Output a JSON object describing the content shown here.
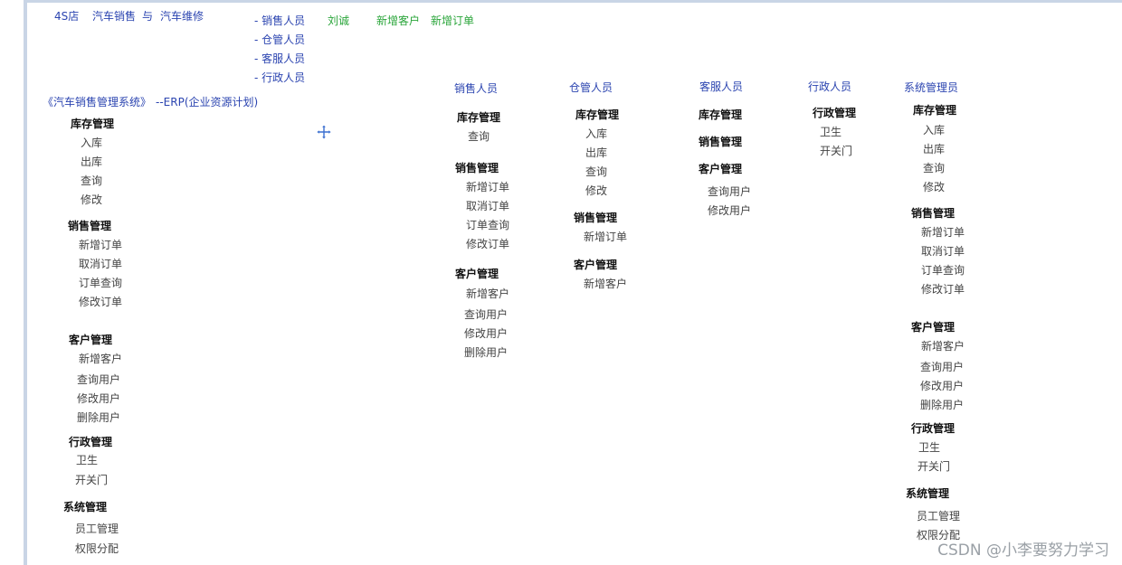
{
  "header": {
    "brand": "4S店",
    "brand_sub1": "汽车销售",
    "brand_and": "与",
    "brand_sub2": "汽车维修",
    "roles": [
      "- 销售人员",
      "- 仓管人员",
      "- 客服人员",
      "- 行政人员"
    ],
    "person": "刘诚",
    "action1": "新增客户",
    "action2": "新增订单"
  },
  "system_title": "《汽车销售管理系统》",
  "system_subtitle": "--ERP(企业资源计划)",
  "full_tree": {
    "inventory": {
      "title": "库存管理",
      "items": [
        "入库",
        "出库",
        "查询",
        "修改"
      ]
    },
    "sales": {
      "title": "销售管理",
      "items": [
        "新增订单",
        "取消订单",
        "订单查询",
        "修改订单"
      ]
    },
    "customer": {
      "title": "客户管理",
      "items": [
        "新增客户",
        "查询用户",
        "修改用户",
        "删除用户"
      ]
    },
    "admin": {
      "title": "行政管理",
      "items": [
        "卫生",
        "开关门"
      ]
    },
    "system": {
      "title": "系统管理",
      "items": [
        "员工管理",
        "权限分配"
      ]
    }
  },
  "sales_role": {
    "heading": "销售人员",
    "inventory": {
      "title": "库存管理",
      "items": [
        "查询"
      ]
    },
    "sales": {
      "title": "销售管理",
      "items": [
        "新增订单",
        "取消订单",
        "订单查询",
        "修改订单"
      ]
    },
    "customer": {
      "title": "客户管理",
      "items": [
        "新增客户",
        "查询用户",
        "修改用户",
        "删除用户"
      ]
    }
  },
  "warehouse_role": {
    "heading": "仓管人员",
    "inventory": {
      "title": "库存管理",
      "items": [
        "入库",
        "出库",
        "查询",
        "修改"
      ]
    },
    "sales": {
      "title": "销售管理",
      "items": [
        "新增订单"
      ]
    },
    "customer": {
      "title": "客户管理",
      "items": [
        "新增客户"
      ]
    }
  },
  "service_role": {
    "heading": "客服人员",
    "inventory": {
      "title": "库存管理"
    },
    "sales": {
      "title": "销售管理"
    },
    "customer": {
      "title": "客户管理",
      "items": [
        "查询用户",
        "修改用户"
      ]
    }
  },
  "admin_role": {
    "heading": "行政人员",
    "admin": {
      "title": "行政管理",
      "items": [
        "卫生",
        "开关门"
      ]
    }
  },
  "sysadmin_role": {
    "heading": "系统管理员",
    "inventory": {
      "title": "库存管理",
      "items": [
        "入库",
        "出库",
        "查询",
        "修改"
      ]
    },
    "sales": {
      "title": "销售管理",
      "items": [
        "新增订单",
        "取消订单",
        "订单查询",
        "修改订单"
      ]
    },
    "customer": {
      "title": "客户管理",
      "items": [
        "新增客户",
        "查询用户",
        "修改用户",
        "删除用户"
      ]
    },
    "admin": {
      "title": "行政管理",
      "items": [
        "卫生",
        "开关门"
      ]
    },
    "system": {
      "title": "系统管理",
      "items": [
        "员工管理",
        "权限分配"
      ]
    }
  },
  "watermark": "CSDN @小李要努力学习",
  "colors": {
    "blue": "#2b44b0",
    "green": "#2aa53a",
    "frame": "#c9d5e6"
  },
  "icons": {
    "cursor": "move-crosshair-icon"
  }
}
